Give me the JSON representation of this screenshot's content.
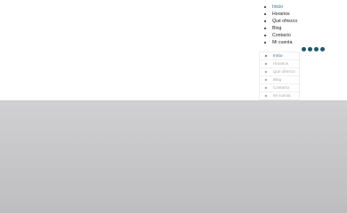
{
  "nav_primary": {
    "items": [
      {
        "label": "Inicio"
      },
      {
        "label": "Horarios"
      },
      {
        "label": "Qué ofrezco"
      },
      {
        "label": "Blog"
      },
      {
        "label": "Contacto"
      },
      {
        "label": "Mi cuenta"
      }
    ]
  },
  "nav_secondary": {
    "items": [
      {
        "label": "Inicio"
      },
      {
        "label": "Horarios"
      },
      {
        "label": "Qué ofrezco"
      },
      {
        "label": "Blog"
      },
      {
        "label": "Contacto"
      },
      {
        "label": "Mi cuenta"
      }
    ]
  },
  "dots": {
    "count_visible": 4,
    "color": "#1e5a68"
  },
  "colors": {
    "accent": "#2f6f86",
    "top_bg": "#ffffff",
    "bottom_bg": "#c6c6c8"
  }
}
